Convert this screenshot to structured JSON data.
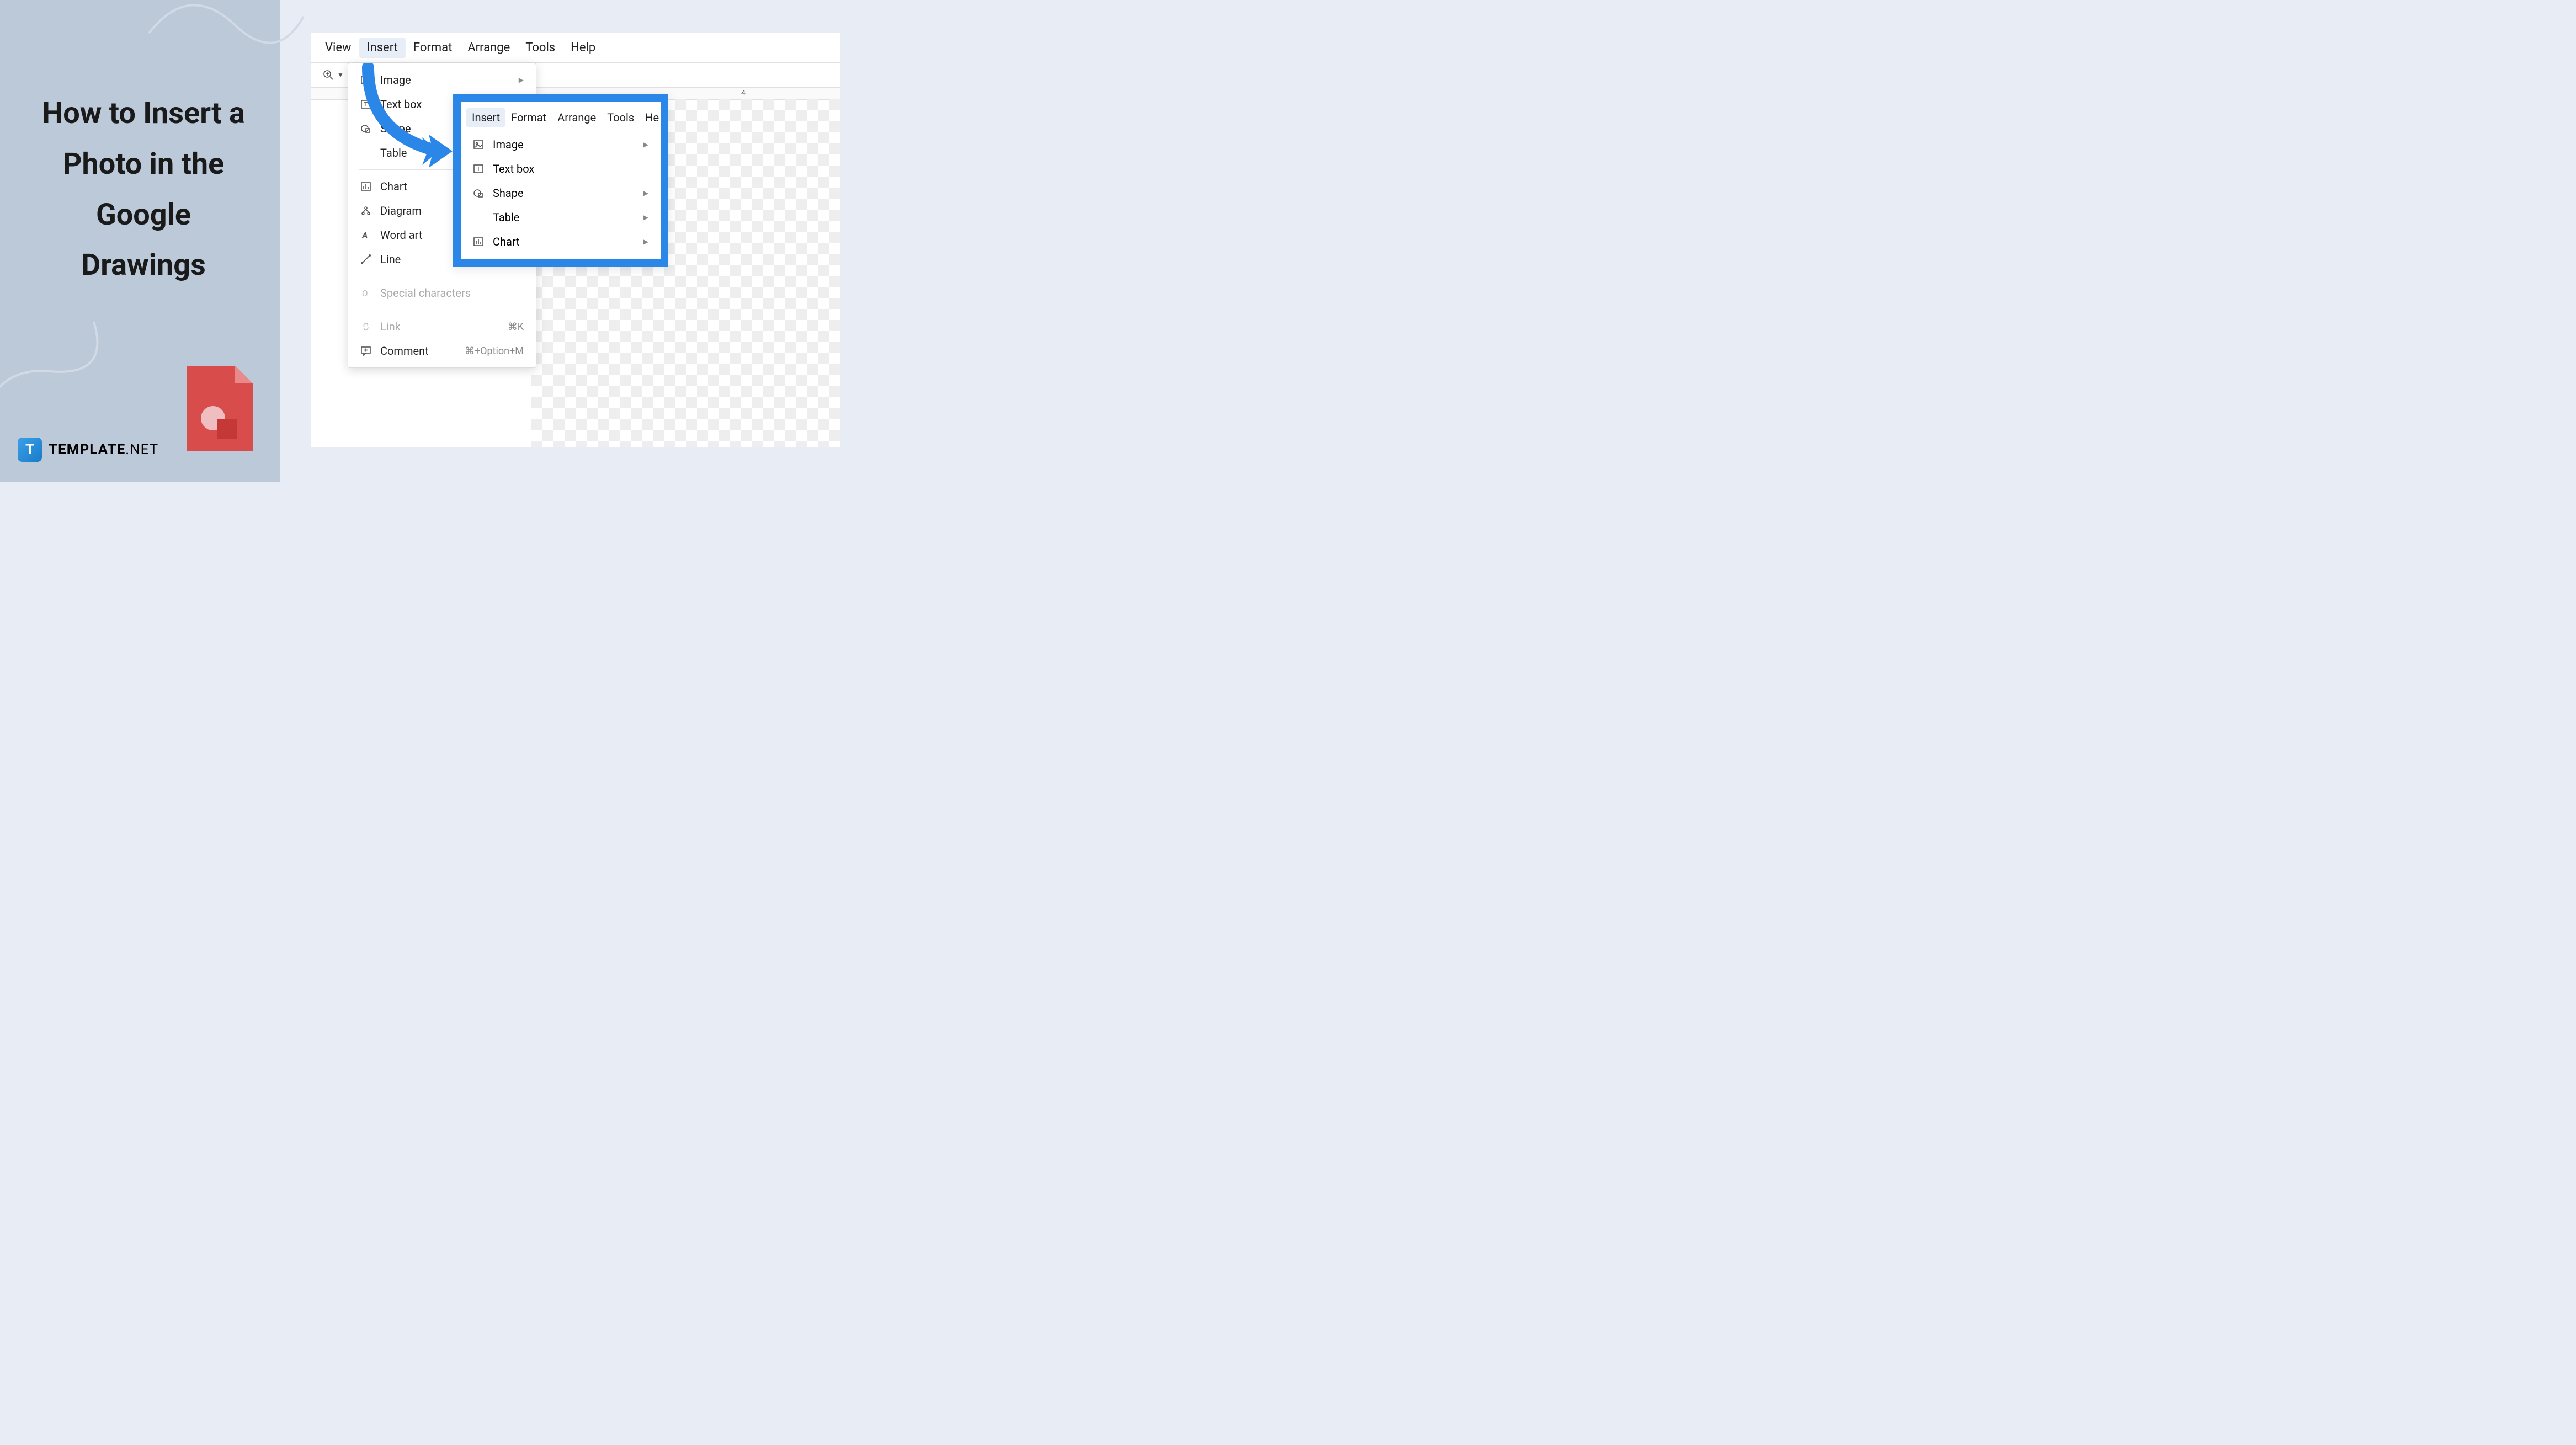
{
  "left": {
    "title": "How to Insert a Photo in the Google Drawings",
    "brand_bold": "TEMPLATE",
    "brand_light": ".NET",
    "logo_letter": "T"
  },
  "menubar": [
    "View",
    "Insert",
    "Format",
    "Arrange",
    "Tools",
    "Help"
  ],
  "ruler": {
    "tick4": "4"
  },
  "insert_menu": {
    "items": [
      {
        "label": "Image",
        "icon": "image-icon",
        "sub": true
      },
      {
        "label": "Text box",
        "icon": "textbox-icon",
        "sub": false
      },
      {
        "label": "Shape",
        "icon": "shape-icon",
        "sub": true
      },
      {
        "label": "Table",
        "icon": "",
        "sub": true
      },
      {
        "label": "Chart",
        "icon": "chart-icon",
        "sub": true
      },
      {
        "label": "Diagram",
        "icon": "diagram-icon",
        "sub": false
      },
      {
        "label": "Word art",
        "icon": "wordart-icon",
        "sub": false
      },
      {
        "label": "Line",
        "icon": "line-icon",
        "sub": true
      }
    ],
    "special": {
      "label": "Special characters",
      "icon": "omega-icon"
    },
    "link": {
      "label": "Link",
      "icon": "link-icon",
      "shortcut": "⌘K"
    },
    "comment": {
      "label": "Comment",
      "icon": "comment-icon",
      "shortcut": "⌘+Option+M"
    }
  },
  "callout": {
    "menubar": [
      "Insert",
      "Format",
      "Arrange",
      "Tools",
      "He"
    ],
    "items": [
      {
        "label": "Image",
        "icon": "image-icon",
        "sub": true
      },
      {
        "label": "Text box",
        "icon": "textbox-icon",
        "sub": false
      },
      {
        "label": "Shape",
        "icon": "shape-icon",
        "sub": true
      },
      {
        "label": "Table",
        "icon": "",
        "sub": true
      },
      {
        "label": "Chart",
        "icon": "chart-icon",
        "sub": true
      }
    ]
  }
}
